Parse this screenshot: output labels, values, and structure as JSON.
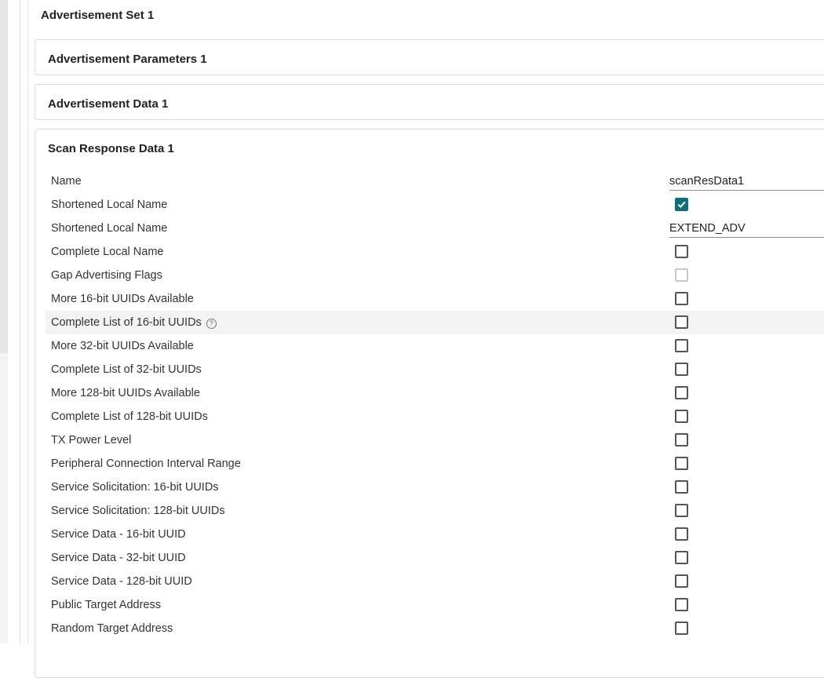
{
  "set_title": "Advertisement Set 1",
  "panels": [
    {
      "title": "Advertisement Parameters 1"
    },
    {
      "title": "Advertisement Data 1"
    },
    {
      "title": "Scan Response Data 1"
    }
  ],
  "accent_color": "#0e6f79",
  "rows": [
    {
      "label": "Name",
      "type": "text",
      "value": "scanResData1"
    },
    {
      "label": "Shortened Local Name",
      "type": "checkbox",
      "checked": true
    },
    {
      "label": "Shortened Local Name",
      "type": "text",
      "value": "EXTEND_ADV"
    },
    {
      "label": "Complete Local Name",
      "type": "checkbox",
      "checked": false
    },
    {
      "label": "Gap Advertising Flags",
      "type": "checkbox",
      "checked": false,
      "disabled": true
    },
    {
      "label": "More 16-bit UUIDs Available",
      "type": "checkbox",
      "checked": false
    },
    {
      "label": "Complete List of 16-bit UUIDs",
      "type": "checkbox",
      "checked": false,
      "help": true,
      "help_icon": "?",
      "highlight": true
    },
    {
      "label": "More 32-bit UUIDs Available",
      "type": "checkbox",
      "checked": false
    },
    {
      "label": "Complete List of 32-bit UUIDs",
      "type": "checkbox",
      "checked": false
    },
    {
      "label": "More 128-bit UUIDs Available",
      "type": "checkbox",
      "checked": false
    },
    {
      "label": "Complete List of 128-bit UUIDs",
      "type": "checkbox",
      "checked": false
    },
    {
      "label": "TX Power Level",
      "type": "checkbox",
      "checked": false
    },
    {
      "label": "Peripheral Connection Interval Range",
      "type": "checkbox",
      "checked": false
    },
    {
      "label": "Service Solicitation: 16-bit UUIDs",
      "type": "checkbox",
      "checked": false
    },
    {
      "label": "Service Solicitation: 128-bit UUIDs",
      "type": "checkbox",
      "checked": false
    },
    {
      "label": "Service Data - 16-bit UUID",
      "type": "checkbox",
      "checked": false
    },
    {
      "label": "Service Data - 32-bit UUID",
      "type": "checkbox",
      "checked": false
    },
    {
      "label": "Service Data - 128-bit UUID",
      "type": "checkbox",
      "checked": false
    },
    {
      "label": "Public Target Address",
      "type": "checkbox",
      "checked": false
    },
    {
      "label": "Random Target Address",
      "type": "checkbox",
      "checked": false
    }
  ]
}
